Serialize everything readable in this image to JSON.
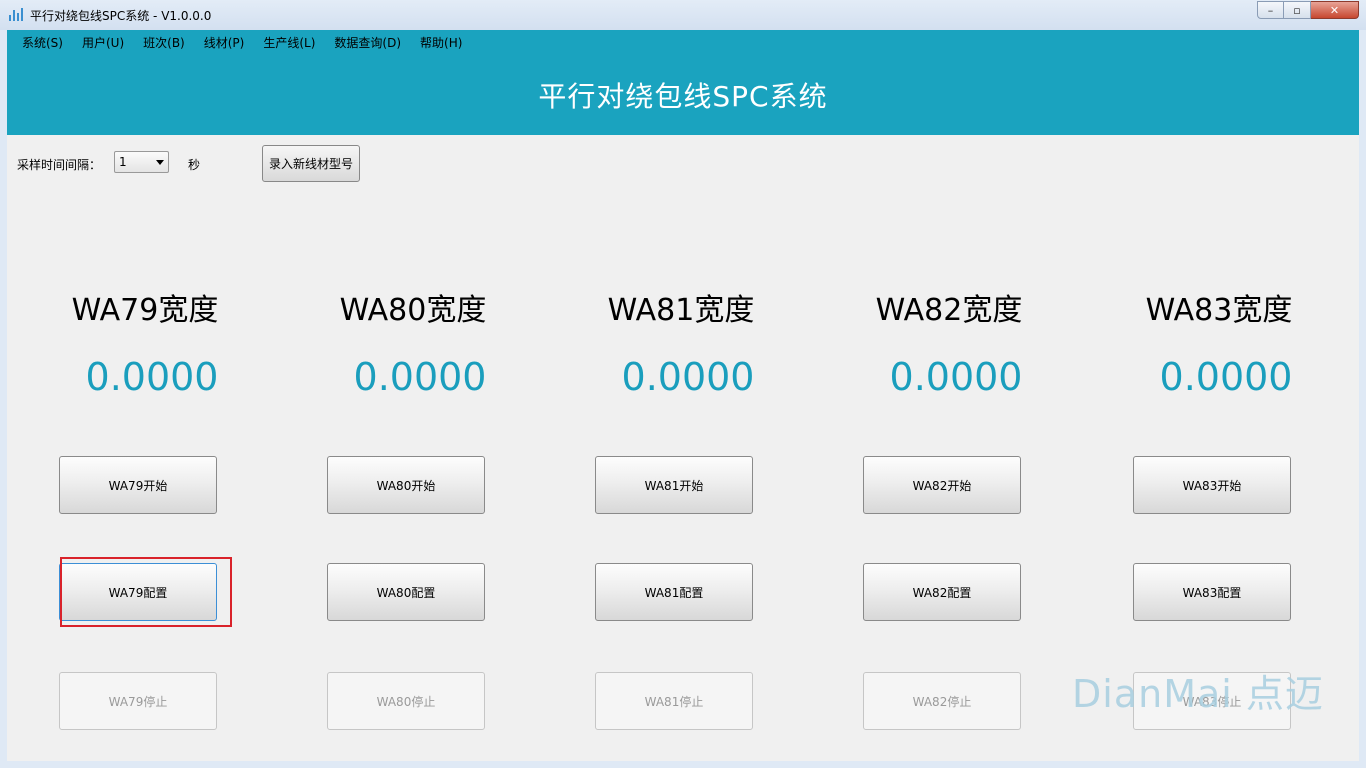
{
  "window": {
    "title": "平行对绕包线SPC系统 - V1.0.0.0",
    "controls": {
      "minimize": "–",
      "maximize": "▫",
      "close": "✕"
    }
  },
  "menu": [
    "系统(S)",
    "用户(U)",
    "班次(B)",
    "线材(P)",
    "生产线(L)",
    "数据查询(D)",
    "帮助(H)"
  ],
  "banner": {
    "title": "平行对绕包线SPC系统"
  },
  "toolbar": {
    "interval_label": "采样时间间隔：",
    "interval_value": "1",
    "unit": "秒",
    "new_wire_button": "录入新线材型号"
  },
  "lines": [
    {
      "title": "WA79宽度",
      "value": "0.0000",
      "start": "WA79开始",
      "config": "WA79配置",
      "stop": "WA79停止"
    },
    {
      "title": "WA80宽度",
      "value": "0.0000",
      "start": "WA80开始",
      "config": "WA80配置",
      "stop": "WA80停止"
    },
    {
      "title": "WA81宽度",
      "value": "0.0000",
      "start": "WA81开始",
      "config": "WA81配置",
      "stop": "WA81停止"
    },
    {
      "title": "WA82宽度",
      "value": "0.0000",
      "start": "WA82开始",
      "config": "WA82配置",
      "stop": "WA82停止"
    },
    {
      "title": "WA83宽度",
      "value": "0.0000",
      "start": "WA83开始",
      "config": "WA83配置",
      "stop": "WA83停止"
    }
  ],
  "watermark": "DianMai 点迈",
  "colors": {
    "accent": "#1aa3bf",
    "value": "#1a9ebd",
    "highlight": "#d9222a"
  }
}
